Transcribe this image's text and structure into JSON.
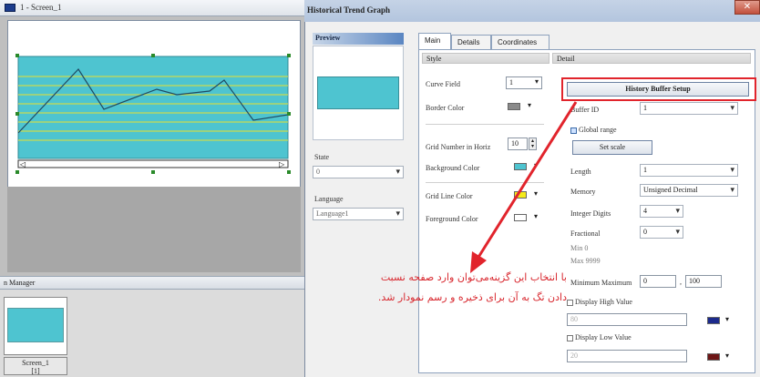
{
  "left_panel": {
    "screen_title": "1 - Screen_1",
    "manager_title": "n Manager",
    "thumb_label_name": "Screen_1",
    "thumb_label_index": "[1]",
    "scroll_left_glyph": "◁",
    "scroll_right_glyph": "▷"
  },
  "dialog": {
    "title": "Historical Trend Graph",
    "close_glyph": "✕",
    "preview_label": "Preview",
    "state_label": "State",
    "state_value": "0",
    "language_label": "Language",
    "language_value": "Language1",
    "tabs": [
      {
        "label": "Main",
        "active": true
      },
      {
        "label": "Details",
        "active": false
      },
      {
        "label": "Coordinates",
        "active": false
      }
    ],
    "style": {
      "header": "Style",
      "curve_field_label": "Curve Field",
      "curve_field_value": "1",
      "border_color_label": "Border Color",
      "grid_number_label": "Grid Number in Horiz",
      "grid_number_value": "10",
      "background_color_label": "Background Color",
      "grid_line_color_label": "Grid Line Color",
      "foreground_color_label": "Foreground Color"
    },
    "detail": {
      "header": "Detail",
      "history_buffer_button": "History Buffer Setup",
      "buffer_id_label": "Buffer ID",
      "buffer_id_value": "1",
      "global_range_label": "Global range",
      "set_scale_button": "Set scale",
      "length_label": "Length",
      "length_value": "1",
      "memory_label": "Memory",
      "memory_value": "Unsigned Decimal",
      "integer_digits_label": "Integer Digits",
      "integer_digits_value": "4",
      "fractional_label": "Fractional",
      "fractional_value": "0",
      "min_label": "Min 0",
      "max_label": "Max 9999",
      "min_max_label": "Minimum Maximum",
      "min_value": "0",
      "max_value": "100",
      "display_high_label": "Display High Value",
      "high_value": "80",
      "display_low_label": "Display Low Value",
      "low_value": "20"
    }
  },
  "annotation": {
    "line1": "با انتخاب این گزینه‌می‌توان وارد صفحه نسبت",
    "line2": "دادن تگ به آن برای ذخیره و رسم نمودار شد."
  },
  "colors": {
    "chart_fill": "#4ec4d0",
    "grid_line": "#e8e030",
    "border_swatch": "#8a8a8a",
    "background_swatch": "#4ec4d0",
    "grid_line_swatch": "#f5ea1a",
    "foreground_swatch": "#ffffff",
    "high_swatch": "#1c2a8c",
    "low_swatch": "#6e1616",
    "highlight": "#e1242c"
  }
}
